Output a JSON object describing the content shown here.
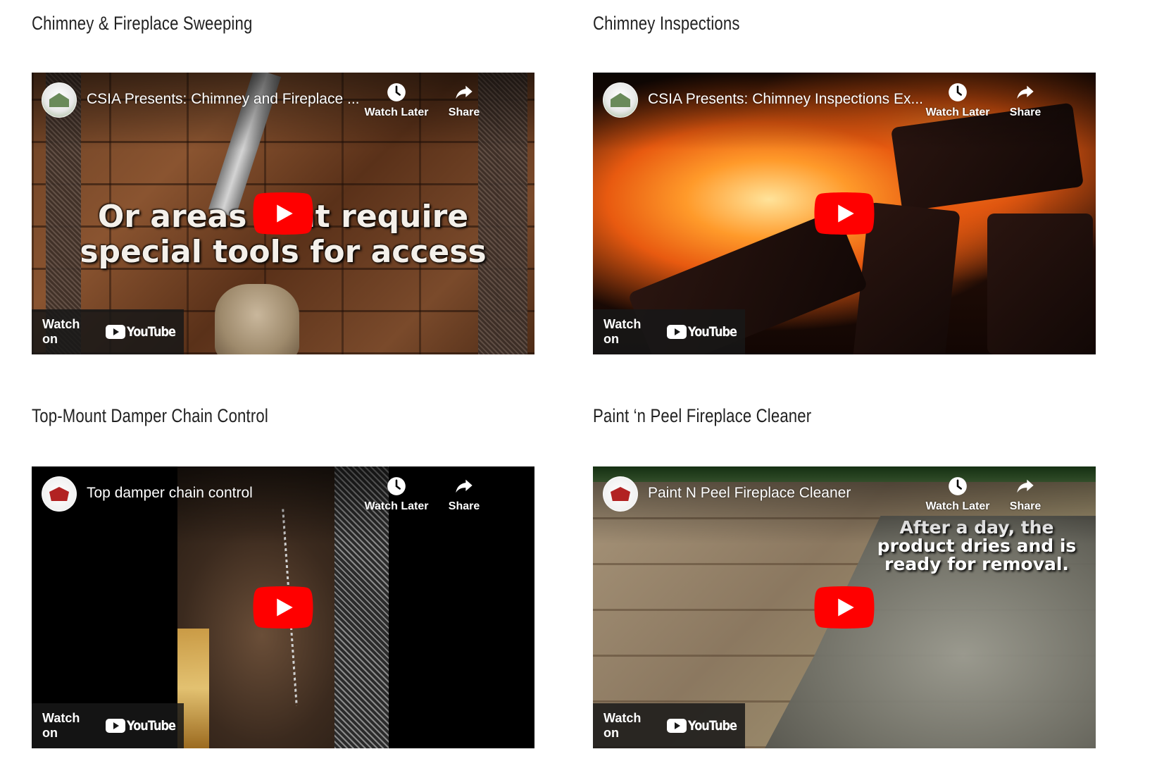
{
  "sections": [
    {
      "heading": "Chimney & Fireplace Sweeping",
      "video_title": "CSIA Presents: Chimney and Fireplace ...",
      "thumbnail_caption": "Or areas that require special tools for access"
    },
    {
      "heading": "Chimney Inspections",
      "video_title": "CSIA Presents: Chimney Inspections Ex..."
    },
    {
      "heading": "Top-Mount Damper Chain Control",
      "video_title": "Top damper chain control"
    },
    {
      "heading": "Paint ‘n Peel Fireplace Cleaner",
      "video_title": "Paint N Peel Fireplace Cleaner",
      "thumbnail_caption": "After a day, the product dries and is ready for removal."
    }
  ],
  "player": {
    "watch_later_label": "Watch Later",
    "share_label": "Share",
    "watch_on_label": "Watch on",
    "youtube_label": "YouTube"
  },
  "colors": {
    "youtube_red": "#ff0000",
    "heading_text": "#222222",
    "overlay_bg": "#171717"
  },
  "icons": [
    "clock-icon",
    "share-arrow-icon",
    "play-icon",
    "youtube-logo-icon"
  ]
}
